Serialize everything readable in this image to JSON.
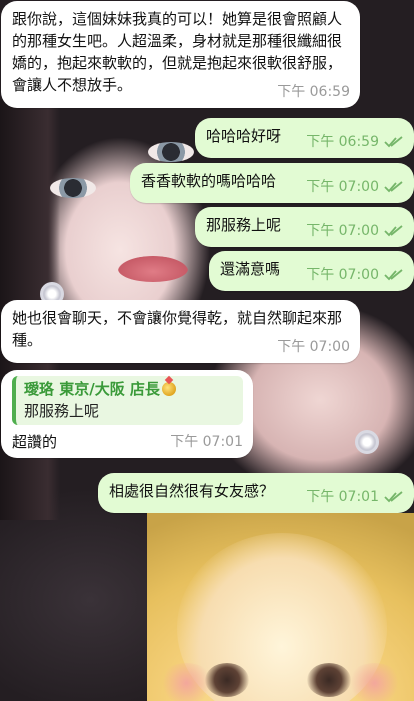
{
  "messages": [
    {
      "side": "in",
      "text": "跟你說，這個妹妹我真的可以！她算是很會照顧人的那種女生吧。人超溫柔，身材就是那種很纖細很嬌的，抱起來軟軟的，但就是抱起來很軟很舒服，會讓人不想放手。",
      "time": "下午 06:59"
    },
    {
      "side": "out",
      "text": "哈哈哈好呀",
      "time": "下午 06:59"
    },
    {
      "side": "out",
      "text": "香香軟軟的嗎哈哈哈",
      "time": "下午 07:00"
    },
    {
      "side": "out",
      "text": "那服務上呢",
      "time": "下午 07:00"
    },
    {
      "side": "out",
      "text": "還滿意嗎",
      "time": "下午 07:00"
    },
    {
      "side": "in",
      "text": "她也很會聊天，不會讓你覺得乾，就自然聊起來那種。",
      "time": "下午 07:00"
    },
    {
      "side": "in",
      "reply_name": "璦珞 東京/大阪 店長",
      "reply_text": "那服務上呢",
      "text": "超讚的",
      "time": "下午 07:01"
    },
    {
      "side": "out",
      "text": "相處很自然很有女友感？",
      "time": "下午 07:01"
    }
  ],
  "icons": {
    "read_receipt": "double-check-icon",
    "badge": "medal-icon"
  },
  "colors": {
    "outgoing_bg": "#e2fbd3",
    "incoming_bg": "#ffffff",
    "accent": "#4fae4e"
  }
}
